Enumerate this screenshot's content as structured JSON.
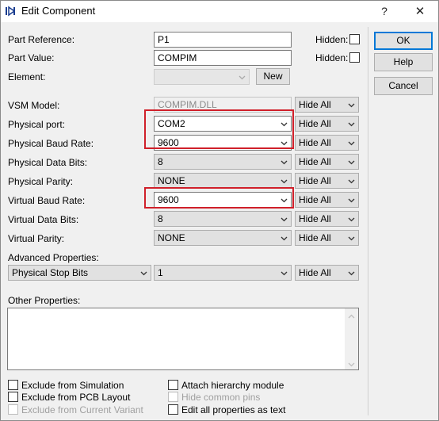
{
  "window": {
    "title": "Edit Component"
  },
  "titlebar": {
    "help_label": "?",
    "close_label": "✕"
  },
  "fields": {
    "part_reference": {
      "label": "Part Reference:",
      "value": "P1",
      "hidden_label": "Hidden:"
    },
    "part_value": {
      "label": "Part Value:",
      "value": "COMPIM",
      "hidden_label": "Hidden:"
    },
    "element": {
      "label": "Element:",
      "value": "",
      "new_label": "New"
    }
  },
  "properties": [
    {
      "label": "VSM Model:",
      "value": "COMPIM.DLL",
      "visibility": "Hide All"
    },
    {
      "label": "Physical port:",
      "value": "COM2",
      "visibility": "Hide All"
    },
    {
      "label": "Physical Baud Rate:",
      "value": "9600",
      "visibility": "Hide All"
    },
    {
      "label": "Physical Data Bits:",
      "value": "8",
      "visibility": "Hide All"
    },
    {
      "label": "Physical Parity:",
      "value": "NONE",
      "visibility": "Hide All"
    },
    {
      "label": "Virtual Baud Rate:",
      "value": "9600",
      "visibility": "Hide All"
    },
    {
      "label": "Virtual Data Bits:",
      "value": "8",
      "visibility": "Hide All"
    },
    {
      "label": "Virtual Parity:",
      "value": "NONE",
      "visibility": "Hide All"
    }
  ],
  "advanced": {
    "label": "Advanced Properties:",
    "property": "Physical Stop Bits",
    "value": "1",
    "visibility": "Hide All"
  },
  "other_properties": {
    "label": "Other Properties:",
    "value": ""
  },
  "buttons": {
    "ok": "OK",
    "help": "Help",
    "cancel": "Cancel"
  },
  "checkboxes": {
    "exclude_simulation": "Exclude from Simulation",
    "exclude_pcb": "Exclude from PCB Layout",
    "exclude_variant": "Exclude from Current Variant",
    "attach_hierarchy": "Attach hierarchy module",
    "hide_common_pins": "Hide common pins",
    "edit_as_text": "Edit all properties as text"
  },
  "colors": {
    "highlight": "#d0202a",
    "default_button_border": "#0078d7"
  }
}
